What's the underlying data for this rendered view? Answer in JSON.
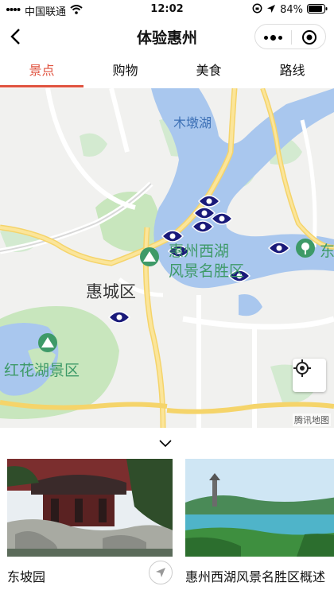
{
  "status_bar": {
    "carrier": "中国联通",
    "time": "12:02",
    "battery": "84%"
  },
  "nav": {
    "title": "体验惠州"
  },
  "tabs": [
    {
      "label": "景点",
      "active": true
    },
    {
      "label": "购物",
      "active": false
    },
    {
      "label": "美食",
      "active": false
    },
    {
      "label": "路线",
      "active": false
    }
  ],
  "map": {
    "labels": {
      "lake_top": "木墩湖",
      "west_lake_1": "惠州西湖",
      "west_lake_2": "风景名胜区",
      "district": "惠城区",
      "honghua_lake": "红花湖景区",
      "east_cut": "东"
    },
    "attribution": "腾讯地图",
    "marker_color": "#1a1a7a",
    "water_color": "#a9c7ee",
    "park_color": "#bfe4b6",
    "road_color": "#f7d774"
  },
  "cards": [
    {
      "name": "东坡园"
    },
    {
      "name": "惠州西湖风景名胜区概述"
    }
  ],
  "colors": {
    "accent": "#e0533f"
  }
}
